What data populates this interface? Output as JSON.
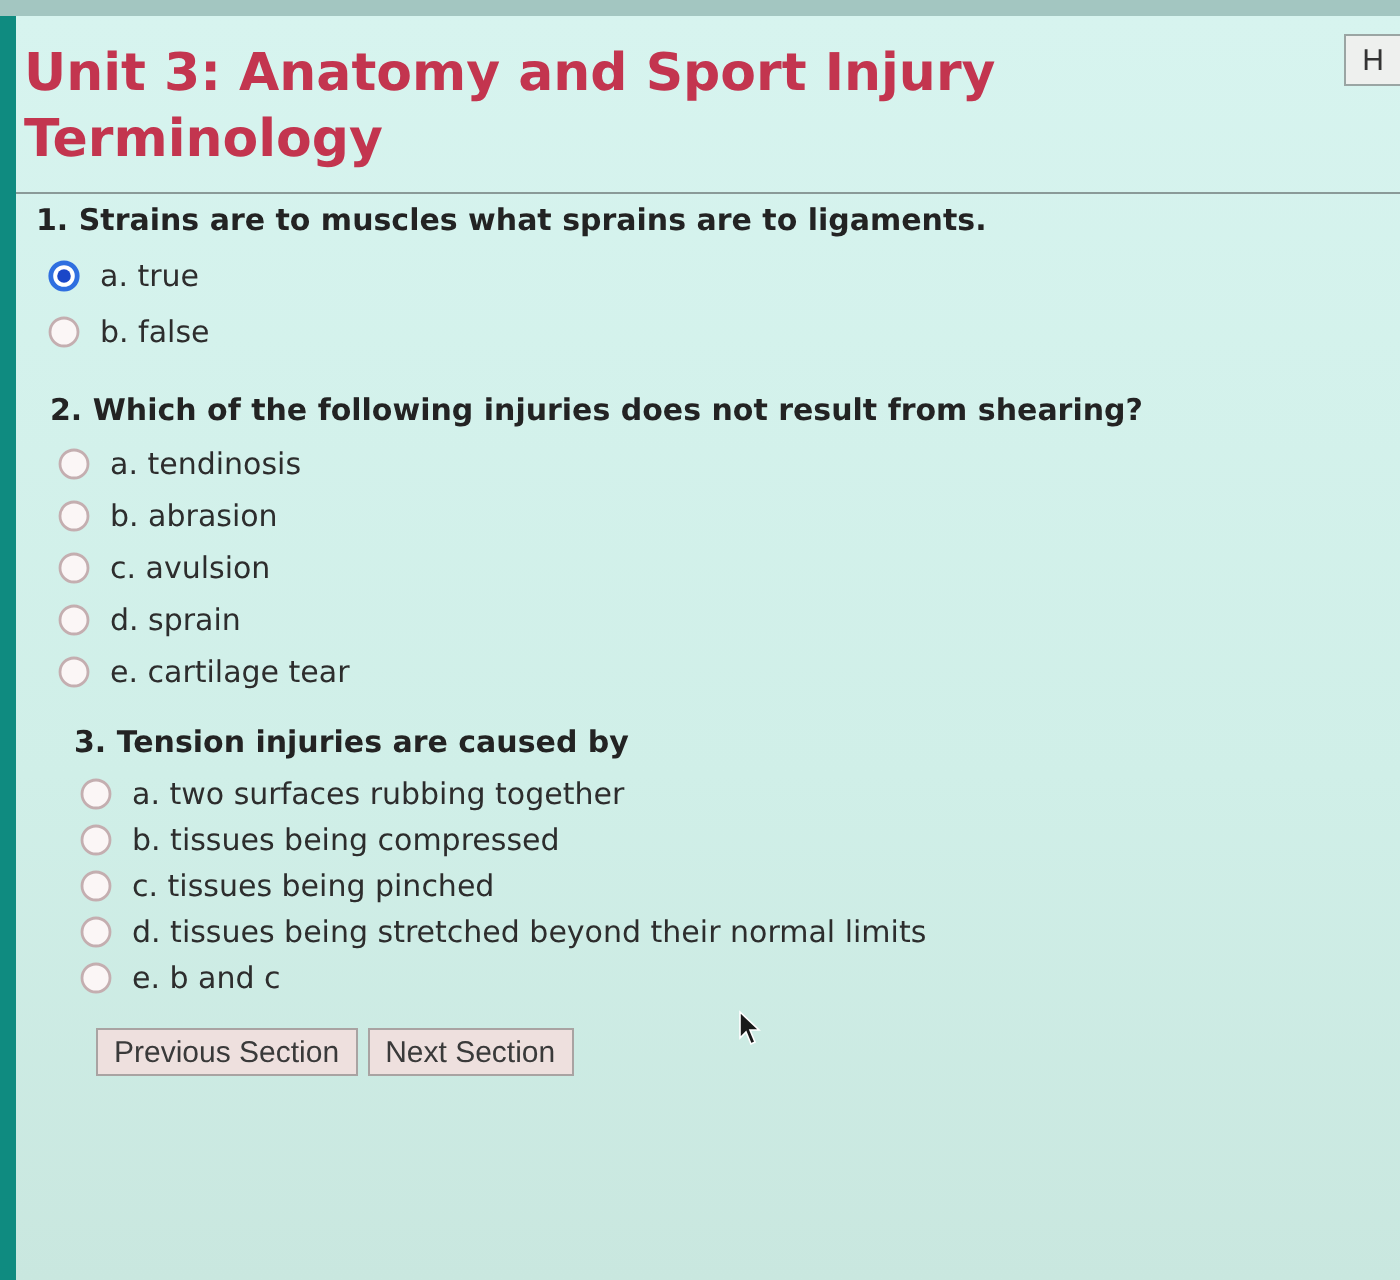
{
  "header": {
    "title": "Unit 3: Anatomy and Sport Injury Terminology",
    "button": "H"
  },
  "questions": [
    {
      "text": "1. Strains are to muscles what sprains are to ligaments.",
      "options": [
        {
          "label": "a. true",
          "selected": true
        },
        {
          "label": "b. false",
          "selected": false
        }
      ]
    },
    {
      "text": "2. Which of the following injuries does not result from shearing?",
      "options": [
        {
          "label": "a. tendinosis",
          "selected": false
        },
        {
          "label": "b. abrasion",
          "selected": false
        },
        {
          "label": "c. avulsion",
          "selected": false
        },
        {
          "label": "d. sprain",
          "selected": false
        },
        {
          "label": "e. cartilage tear",
          "selected": false
        }
      ]
    },
    {
      "text": "3. Tension injuries are caused by",
      "options": [
        {
          "label": "a. two surfaces rubbing together",
          "selected": false
        },
        {
          "label": "b. tissues being compressed",
          "selected": false
        },
        {
          "label": "c. tissues being pinched",
          "selected": false
        },
        {
          "label": "d. tissues being stretched beyond their normal limits",
          "selected": false
        },
        {
          "label": "e. b and c",
          "selected": false
        }
      ]
    }
  ],
  "buttons": [
    "Previous Section",
    "Next Section"
  ]
}
